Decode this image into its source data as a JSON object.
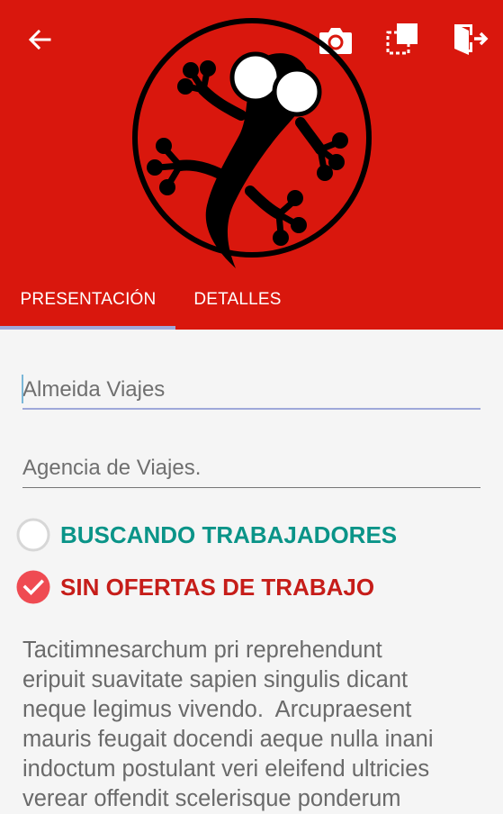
{
  "header": {
    "back_icon": "arrow-left-icon",
    "camera_icon": "camera-icon",
    "select_icon": "select-area-icon",
    "exit_icon": "logout-icon",
    "background_color": "#d9170d",
    "logo": "gecko-logo"
  },
  "tabs": [
    {
      "label": "PRESENTACIÓN",
      "active": true
    },
    {
      "label": "DETALLES",
      "active": false
    }
  ],
  "form": {
    "name_value": "Almeida Viajes",
    "type_value": "Agencia de Viajes."
  },
  "status_options": [
    {
      "label": "BUSCANDO TRABAJADORES",
      "checked": false,
      "color": "#0a9488"
    },
    {
      "label": "SIN OFERTAS DE TRABAJO",
      "checked": true,
      "color": "#c61d19"
    }
  ],
  "description": "Tacitimnesarchum pri reprehendunt\neripuit suavitate sapien singulis dicant\nneque legimus vivendo.  Arcupraesent\nmauris feugait docendi aeque nulla inani\nindoctum postulant veri eleifend ultricies\nverear offendit scelerisque ponderum"
}
